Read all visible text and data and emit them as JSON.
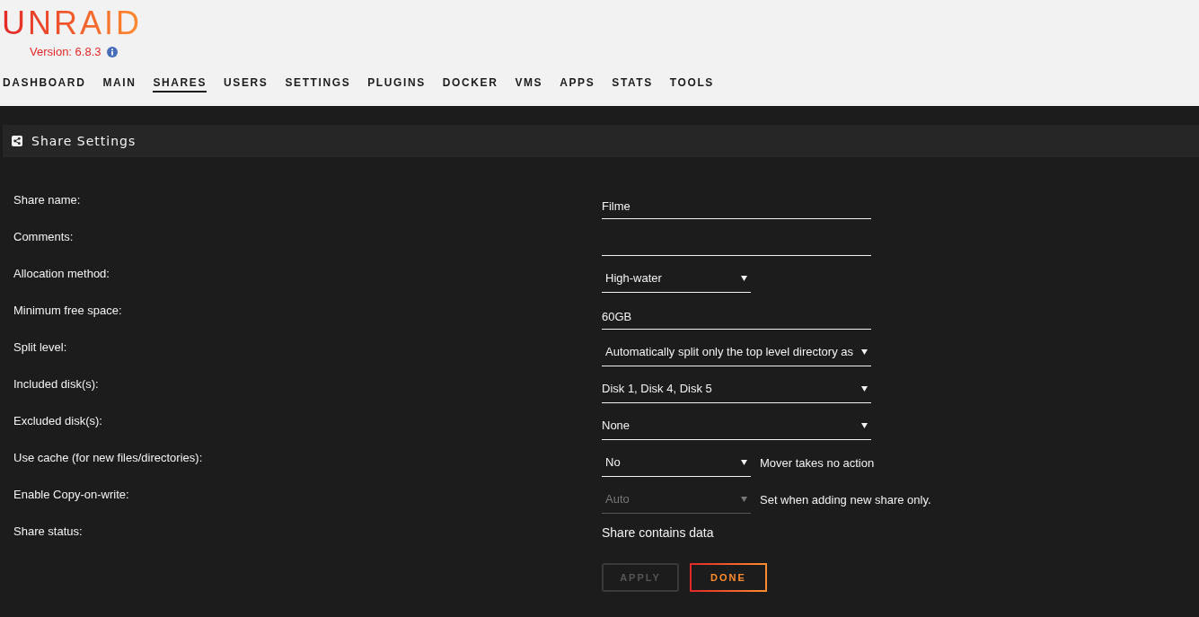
{
  "header": {
    "logo": "UNRAID",
    "version": "Version: 6.8.3"
  },
  "nav": [
    {
      "label": "DASHBOARD",
      "selected": false
    },
    {
      "label": "MAIN",
      "selected": false
    },
    {
      "label": "SHARES",
      "selected": true
    },
    {
      "label": "USERS",
      "selected": false
    },
    {
      "label": "SETTINGS",
      "selected": false
    },
    {
      "label": "PLUGINS",
      "selected": false
    },
    {
      "label": "DOCKER",
      "selected": false
    },
    {
      "label": "VMS",
      "selected": false
    },
    {
      "label": "APPS",
      "selected": false
    },
    {
      "label": "STATS",
      "selected": false
    },
    {
      "label": "TOOLS",
      "selected": false
    }
  ],
  "panel": {
    "title": "Share Settings"
  },
  "fields": [
    {
      "label": "Share name:",
      "kind": "text",
      "value": "Filme"
    },
    {
      "label": "Comments:",
      "kind": "text"
    },
    {
      "label": "Allocation method:",
      "kind": "dropdown",
      "value": "High-water",
      "disabled": false
    },
    {
      "label": "Minimum free space:",
      "kind": "text",
      "value": "60GB"
    },
    {
      "label": "Split level:",
      "kind": "dropdown-long",
      "value": "Automatically split only the top level directory as",
      "disabled": false
    },
    {
      "label": "Included disk(s):",
      "kind": "disk-picker",
      "value": "Disk 1, Disk 4, Disk 5"
    },
    {
      "label": "Excluded disk(s):",
      "kind": "disk-picker",
      "value": "None"
    },
    {
      "label": "Use cache (for new files/directories):",
      "kind": "dropdown",
      "value": "No",
      "disabled": false,
      "note": "Mover takes no action"
    },
    {
      "label": "Enable Copy-on-write:",
      "kind": "dropdown",
      "value": "Auto",
      "disabled": true,
      "note": "Set when adding new share only."
    },
    {
      "label": "Share status:",
      "kind": "status",
      "value": "Share contains data"
    }
  ],
  "buttons": [
    {
      "label": "APPLY",
      "disabled": true
    },
    {
      "label": "DONE",
      "disabled": false
    }
  ]
}
